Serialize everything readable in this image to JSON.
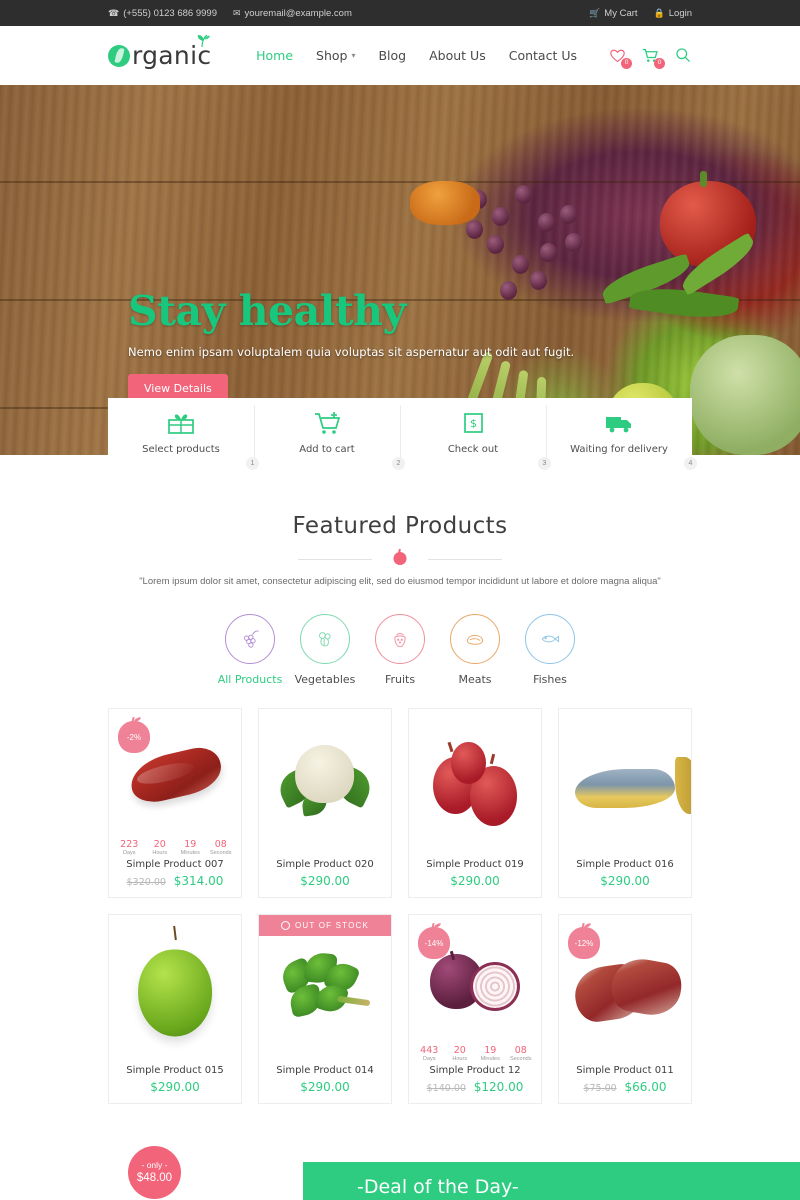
{
  "topbar": {
    "phone": "(+555) 0123 686 9999",
    "email": "youremail@example.com",
    "my_cart": "My Cart",
    "login": "Login",
    "phone_icon": "phone-icon",
    "mail_icon": "mail-icon",
    "cart_icon": "cart-icon",
    "lock_icon": "lock-icon"
  },
  "header": {
    "logo_text": "rganic",
    "nav": [
      {
        "label": "Home",
        "active": true,
        "has_caret": false
      },
      {
        "label": "Shop",
        "active": false,
        "has_caret": true
      },
      {
        "label": "Blog",
        "active": false,
        "has_caret": false
      },
      {
        "label": "About Us",
        "active": false,
        "has_caret": false
      },
      {
        "label": "Contact Us",
        "active": false,
        "has_caret": false
      }
    ],
    "wishlist_count": "0",
    "cart_count": "0"
  },
  "hero": {
    "title": "Stay healthy",
    "subtitle": "Nemo enim ipsam voluptalem quia voluptas sit aspernatur aut odit aut fugit.",
    "button": "View Details"
  },
  "steps": [
    {
      "num": "1",
      "label": "Select products",
      "icon": "gift-icon"
    },
    {
      "num": "2",
      "label": "Add to cart",
      "icon": "cart-plus-icon"
    },
    {
      "num": "3",
      "label": "Check out",
      "icon": "money-icon"
    },
    {
      "num": "4",
      "label": "Waiting for delivery",
      "icon": "truck-icon"
    }
  ],
  "featured": {
    "title": "Featured Products",
    "quote": "\"Lorem ipsum dolor sit amet, consectetur adipiscing elit, sed do eiusmod tempor incididunt ut labore et dolore magna aliqua\""
  },
  "categories": [
    {
      "label": "All Products",
      "color": "#b48ed6",
      "active": true,
      "icon": "grapes-icon"
    },
    {
      "label": "Vegetables",
      "color": "#7fd9b0",
      "active": false,
      "icon": "broccoli-icon"
    },
    {
      "label": "Fruits",
      "color": "#f2909e",
      "active": false,
      "icon": "strawberry-icon"
    },
    {
      "label": "Meats",
      "color": "#e8a86a",
      "active": false,
      "icon": "steak-icon"
    },
    {
      "label": "Fishes",
      "color": "#8ec5e8",
      "active": false,
      "icon": "fish-icon"
    }
  ],
  "countdown_labels": {
    "days": "Days",
    "hours": "Hours",
    "minutes": "Minutes",
    "seconds": "Seconds"
  },
  "out_of_stock_label": "OUT OF STOCK",
  "products": [
    {
      "title": "Simple Product 007",
      "image": "steak",
      "badge": "-2%",
      "out_of_stock": false,
      "countdown": {
        "days": "223",
        "hours": "20",
        "minutes": "19",
        "seconds": "08"
      },
      "price_old": "$320.00",
      "price_new": "$314.00"
    },
    {
      "title": "Simple Product 020",
      "image": "cauliflower",
      "badge": null,
      "out_of_stock": false,
      "countdown": null,
      "price_old": null,
      "price_new": "$290.00"
    },
    {
      "title": "Simple Product 019",
      "image": "pomegranate",
      "badge": null,
      "out_of_stock": false,
      "countdown": null,
      "price_old": null,
      "price_new": "$290.00"
    },
    {
      "title": "Simple Product 016",
      "image": "fish",
      "badge": null,
      "out_of_stock": false,
      "countdown": null,
      "price_old": null,
      "price_new": "$290.00"
    },
    {
      "title": "Simple Product 015",
      "image": "green-apple",
      "badge": null,
      "out_of_stock": false,
      "countdown": null,
      "price_old": null,
      "price_new": "$290.00"
    },
    {
      "title": "Simple Product 014",
      "image": "parsley",
      "badge": null,
      "out_of_stock": true,
      "countdown": null,
      "price_old": null,
      "price_new": "$290.00"
    },
    {
      "title": "Simple Product 12",
      "image": "onion",
      "badge": "-14%",
      "out_of_stock": false,
      "countdown": {
        "days": "443",
        "hours": "20",
        "minutes": "19",
        "seconds": "08"
      },
      "price_old": "$140.00",
      "price_new": "$120.00"
    },
    {
      "title": "Simple Product 011",
      "image": "lamb-chops",
      "badge": "-12%",
      "out_of_stock": false,
      "countdown": null,
      "price_old": "$75.00",
      "price_new": "$66.00"
    }
  ],
  "deal": {
    "title": "-Deal of the Day-",
    "badge_only": "- only -",
    "badge_price": "$48.00"
  },
  "colors": {
    "green": "#2ecc81",
    "pink": "#f2647a",
    "dark": "#2e2e2e"
  }
}
